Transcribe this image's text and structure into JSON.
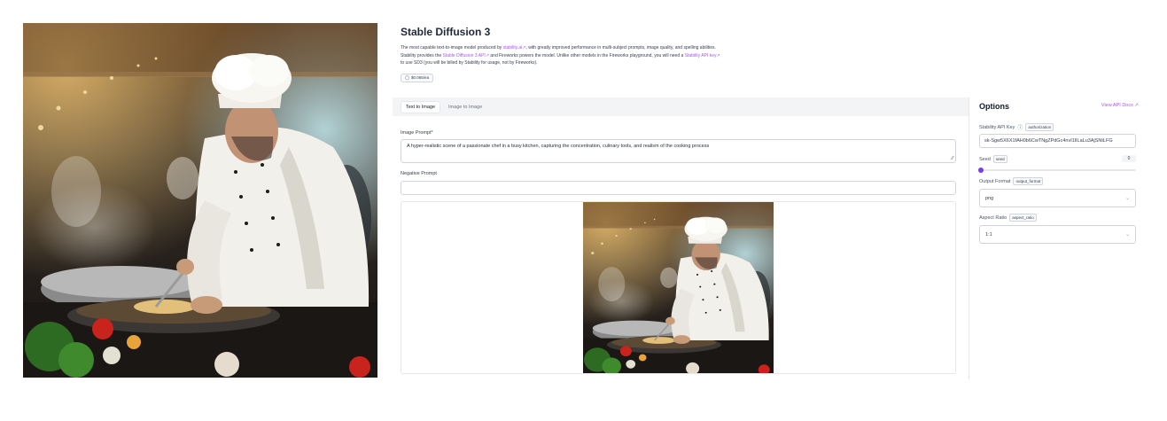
{
  "header": {
    "title": "Stable Diffusion 3",
    "desc_line1_a": "The most capable text-to-image model produced by ",
    "desc_line1_link": "stability.ai",
    "desc_line1_b": ", with greatly improved performance in multi-subject prompts, image quality, and spelling abilities.",
    "desc_line2_a": "Stability provides the ",
    "desc_line2_link1": "Stable Diffusion 3 API",
    "desc_line2_b": " and Fireworks powers the model. Unlike other models in the Fireworks playground, you will need a ",
    "desc_line2_link2": "Stability API key",
    "desc_line3": "to use SD3 (you will be billed by Stability for usage, not by Fireworks).",
    "price": "$0.065/ea",
    "external_icon": "external-link-icon"
  },
  "tabs": [
    {
      "label": "Text to Image",
      "active": true
    },
    {
      "label": "Image to Image",
      "active": false
    }
  ],
  "form": {
    "prompt_label": "Image Prompt*",
    "prompt_value": "A hyper-realistic scene of a passionate chef in a busy kitchen, capturing the concentration, culinary tools, and realism of the cooking process",
    "negative_label": "Negative Prompt",
    "negative_value": ""
  },
  "options": {
    "title": "Options",
    "api_docs": "View API Docs",
    "api_key_label": "Stability API Key",
    "api_key_tag": "authorization",
    "api_key_value": "sk-Sgw5X6X1fAH0b6CwTNgZPdGc4nvI1lILaLu3AjSNtLFG",
    "seed_label": "Seed",
    "seed_tag": "seed",
    "seed_value": "0",
    "output_label": "Output Format",
    "output_tag": "output_format",
    "output_value": "png",
    "aspect_label": "Aspect Ratio",
    "aspect_tag": "aspect_ratio",
    "aspect_value": "1:1"
  },
  "colors": {
    "accent": "#a855f7",
    "slider": "#7c3aed"
  }
}
